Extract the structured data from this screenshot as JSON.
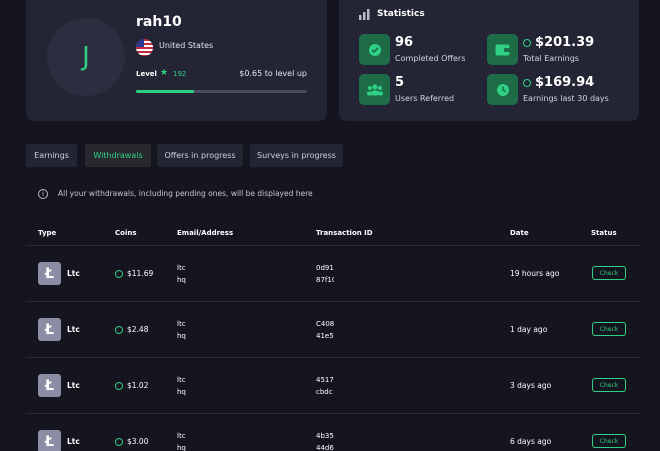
{
  "profile": {
    "avatar_initial": "J",
    "username": "rah10",
    "country": "United States",
    "level_label": "Level",
    "level": "192",
    "to_next_level": "$0.65 to level up",
    "level_progress": 0.34
  },
  "stats": {
    "title": "Statistics",
    "items": [
      {
        "value": "96",
        "label": "Completed Offers",
        "icon": "check-badge-icon"
      },
      {
        "value": "$201.39",
        "label": "Total Earnings",
        "icon": "wallet-icon"
      },
      {
        "value": "5",
        "label": "Users Referred",
        "icon": "users-icon"
      },
      {
        "value": "$169.94",
        "label": "Earnings last 30 days",
        "icon": "clock-icon"
      }
    ]
  },
  "tabs": [
    {
      "label": "Earnings",
      "active": false
    },
    {
      "label": "Withdrawals",
      "active": true
    },
    {
      "label": "Offers in progress",
      "active": false
    },
    {
      "label": "Surveys in progress",
      "active": false
    }
  ],
  "info_text": "All your withdrawals, including pending ones, will be displayed here",
  "table": {
    "headers": [
      "Type",
      "Coins",
      "Email/Address",
      "Transaction ID",
      "Date",
      "Status"
    ],
    "rows": [
      {
        "type": "Ltc",
        "coins": "$11.69",
        "email_1": "ltc",
        "email_2": "hq",
        "tx_1": "0d91",
        "tx_2": "87f10",
        "date": "19 hours ago",
        "status": "Check"
      },
      {
        "type": "Ltc",
        "coins": "$2.48",
        "email_1": "ltc",
        "email_2": "hq",
        "tx_1": "C408",
        "tx_2": "41e5",
        "date": "1 day ago",
        "status": "Check"
      },
      {
        "type": "Ltc",
        "coins": "$1.02",
        "email_1": "ltc",
        "email_2": "hq",
        "tx_1": "4517",
        "tx_2": "cbdc",
        "date": "3 days ago",
        "status": "Check"
      },
      {
        "type": "Ltc",
        "coins": "$3.00",
        "email_1": "ltc",
        "email_2": "hq",
        "tx_1": "4b35",
        "tx_2": "44d6",
        "date": "6 days ago",
        "status": "Check"
      }
    ]
  },
  "colors": {
    "accent": "#2fd083",
    "background": "#14151f",
    "card": "#232434"
  }
}
